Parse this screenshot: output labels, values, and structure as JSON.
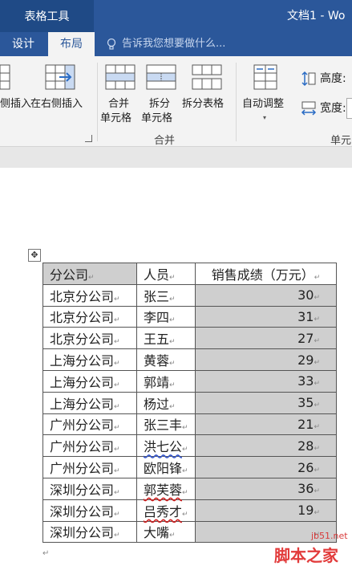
{
  "title_bar": {
    "context_tab": "表格工具",
    "doc_title": "文档1 - Wo"
  },
  "tabs": [
    {
      "label": "设计",
      "active": false
    },
    {
      "label": "布局",
      "active": true
    }
  ],
  "tell_me": {
    "placeholder": "告诉我您想要做什么..."
  },
  "ribbon": {
    "insert_left_partial": "侧插入",
    "insert_right": "在右侧插入",
    "merge_cells": [
      "合并",
      "单元格"
    ],
    "split_cells": [
      "拆分",
      "单元格"
    ],
    "split_table": "拆分表格",
    "autofit": "自动调整",
    "merge_group_label": "合并",
    "height_label": "高度:",
    "width_label": "宽度:",
    "cell_group_partial": "单元"
  },
  "colors": {
    "brand": "#2b579a",
    "ribbon_bg": "#f3f3f3",
    "selection_gray": "#cfcfcf"
  },
  "table": {
    "headers": [
      "分公司",
      "人员",
      "销售成绩（万元）"
    ],
    "rows": [
      [
        "北京分公司",
        "张三",
        "30"
      ],
      [
        "北京分公司",
        "李四",
        "31"
      ],
      [
        "北京分公司",
        "王五",
        "27"
      ],
      [
        "上海分公司",
        "黄蓉",
        "29"
      ],
      [
        "上海分公司",
        "郭靖",
        "33"
      ],
      [
        "上海分公司",
        "杨过",
        "35"
      ],
      [
        "广州分公司",
        "张三丰",
        "21"
      ],
      [
        "广州分公司",
        "洪七公",
        "28"
      ],
      [
        "广州分公司",
        "欧阳锋",
        "26"
      ],
      [
        "深圳分公司",
        "郭芙蓉",
        "36"
      ],
      [
        "深圳分公司",
        "吕秀才",
        "19"
      ],
      [
        "深圳分公司",
        "大嘴",
        ""
      ]
    ]
  },
  "watermark": {
    "site": "jb51.net",
    "name": "脚本之家"
  }
}
